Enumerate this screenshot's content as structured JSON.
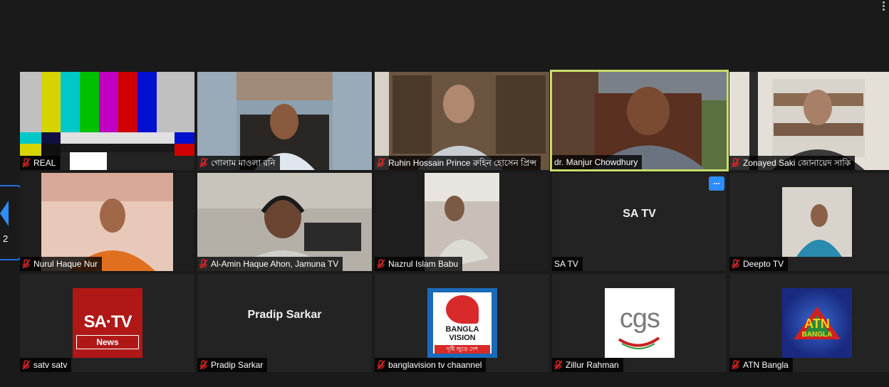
{
  "participants": [
    {
      "name": "REAL",
      "muted": true
    },
    {
      "name": "গোলাম মাওলা রনি",
      "muted": true
    },
    {
      "name": "Ruhin Hossain Prince রুহিন হোসেন প্রিন্স",
      "muted": true
    },
    {
      "name": "dr. Manjur Chowdhury",
      "muted": false,
      "active_speaker": true
    },
    {
      "name": "Zonayed Saki জোনায়েদ সাকি",
      "muted": true
    },
    {
      "name": "Nurul Haque Nur",
      "muted": true
    },
    {
      "name": "Al-Amin Haque Ahon, Jamuna TV",
      "muted": true
    },
    {
      "name": "Nazrul Islam Babu",
      "muted": true
    },
    {
      "name": "SA TV",
      "muted": false,
      "video_off_label": "SA TV",
      "options_label": "..."
    },
    {
      "name": "Deepto TV",
      "muted": true
    },
    {
      "name": "satv satv",
      "muted": true
    },
    {
      "name": "Pradip Sarkar",
      "muted": true,
      "video_off_label": "Pradip Sarkar"
    },
    {
      "name": "banglavision tv chaannel",
      "muted": true
    },
    {
      "name": "Zillur Rahman",
      "muted": true
    },
    {
      "name": "ATN Bangla",
      "muted": true
    }
  ],
  "logos": {
    "satv": {
      "brand": "SA·TV",
      "sub": "News"
    },
    "banglavision": {
      "line1": "BANGLA",
      "line2": "VISION",
      "tagline": "দৃষ্টি জুড়ে দেশ"
    },
    "cgs": {
      "text": "cgs"
    },
    "atn": {
      "text": "ATN",
      "sub": "BANGLA"
    }
  },
  "pager": {
    "page": "2"
  },
  "colors": {
    "active_border": "#c7dc6a",
    "mute_red": "#e02828",
    "accent_blue": "#2d8cff"
  }
}
